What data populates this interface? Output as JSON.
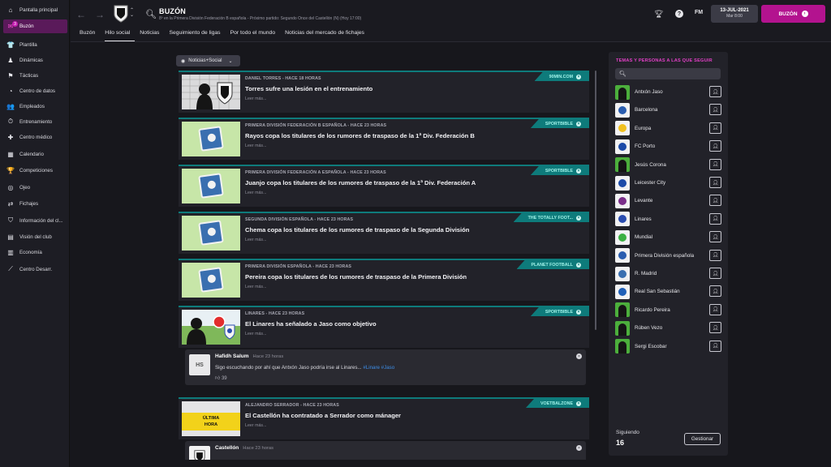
{
  "sidebar": {
    "items": [
      {
        "label": "Pantalla principal",
        "icon": "home-icon"
      },
      {
        "label": "Buzón",
        "icon": "inbox-icon",
        "badge": "3"
      },
      {
        "label": "Plantilla",
        "icon": "shirt-icon"
      },
      {
        "label": "Dinámicas",
        "icon": "dynamics-icon"
      },
      {
        "label": "Tácticas",
        "icon": "tactics-icon"
      },
      {
        "label": "Centro de datos",
        "icon": "data-icon"
      },
      {
        "label": "Empleados",
        "icon": "staff-icon"
      },
      {
        "label": "Entrenamiento",
        "icon": "training-icon"
      },
      {
        "label": "Centro médico",
        "icon": "medical-icon"
      },
      {
        "label": "Calendario",
        "icon": "calendar-icon"
      },
      {
        "label": "Competiciones",
        "icon": "trophy-icon"
      },
      {
        "label": "Ojeo",
        "icon": "scouting-icon"
      },
      {
        "label": "Fichajes",
        "icon": "transfers-icon"
      },
      {
        "label": "Información del cl...",
        "icon": "club-info-icon"
      },
      {
        "label": "Visión del club",
        "icon": "club-vision-icon"
      },
      {
        "label": "Economía",
        "icon": "finance-icon"
      },
      {
        "label": "Centro Desarr.",
        "icon": "development-icon"
      }
    ]
  },
  "header": {
    "title": "BUZÓN",
    "subtitle": "8º en la Primera División Federación B española - Próximo partido: Segundo Once del Castellón (N) (Hoy 17:00)",
    "date": "13-JUL-2021",
    "time": "Mar 8:00",
    "main_button": "BUZÓN",
    "fm_label": "FM",
    "help_label": "?"
  },
  "tabs": [
    "Buzón",
    "Hilo social",
    "Noticias",
    "Seguimiento de ligas",
    "Por todo el mundo",
    "Noticias del mercado de fichajes"
  ],
  "filter": {
    "label": "Noticias+Social"
  },
  "feed": {
    "read_more": "Leer más...",
    "cards": [
      {
        "meta": "DANIEL TORRES  -  HACE 18 HORAS",
        "headline": "Torres sufre una lesión en el entrenamiento",
        "source": "90MIN.COM"
      },
      {
        "meta": "PRIMERA DIVISIÓN FEDERACIÓN B ESPAÑOLA  -  HACE 23 HORAS",
        "headline": "Rayos copa los titulares de los rumores de traspaso de la 1ª Div. Federación B",
        "source": "SPORTBIBLE"
      },
      {
        "meta": "PRIMERA DIVISIÓN FEDERACIÓN A ESPAÑOLA  -  HACE 23 HORAS",
        "headline": "Juanjo copa los titulares de los rumores de traspaso de la 1ª Div. Federación A",
        "source": "SPORTBIBLE"
      },
      {
        "meta": "SEGUNDA DIVISIÓN ESPAÑOLA  -  HACE 23 HORAS",
        "headline": "Chema copa los titulares de los rumores de traspaso de la Segunda División",
        "source": "THE TOTALLY FOOT..."
      },
      {
        "meta": "PRIMERA DIVISIÓN ESPAÑOLA  -  HACE 23 HORAS",
        "headline": "Pereira copa los titulares de los rumores de traspaso de la Primera División",
        "source": "PLANET FOOTBALL"
      },
      {
        "meta": "LINARES  -  HACE 23 HORAS",
        "headline": "El Linares ha señalado a Jaso como objetivo",
        "source": "SPORTBIBLE"
      },
      {
        "meta": "ALEJANDRO SERRADOR  -  HACE 23 HORAS",
        "headline": "El Castellón ha contratado a Serrador como mánager",
        "source": "VOETBALZONE"
      }
    ],
    "tweet": {
      "avatar": "HS",
      "author": "Hafidh Salum",
      "when": "Hace 23 horas",
      "body": "Sigo escuchando por ahí que Antxón Jaso podría irse al Linares... ",
      "tags": "#Linare #Jaso",
      "likes": "39"
    },
    "tweet2": {
      "author": "Castellón",
      "when": "Hace 23 horas"
    },
    "ultima_hora_1": "ÚLTIMA",
    "ultima_hora_2": "HORA"
  },
  "right_panel": {
    "title": "TEMAS Y PERSONAS A LAS QUE SEGUIR",
    "search_icon": "search-icon",
    "following_label": "Siguiendo",
    "following_count": "16",
    "manage_label": "Gestionar",
    "items": [
      {
        "name": "Antxón Jaso",
        "type": "person"
      },
      {
        "name": "Barcelona",
        "type": "club",
        "color": "#2a5db0"
      },
      {
        "name": "Europa",
        "type": "club",
        "color": "#f0c020"
      },
      {
        "name": "FC Porto",
        "type": "club",
        "color": "#1c4aa8"
      },
      {
        "name": "Jesús Corona",
        "type": "person"
      },
      {
        "name": "Leicester City",
        "type": "club",
        "color": "#1c4aa8"
      },
      {
        "name": "Levante",
        "type": "club",
        "color": "#7a2e8a"
      },
      {
        "name": "Linares",
        "type": "club",
        "color": "#2a4db0"
      },
      {
        "name": "Mundial",
        "type": "club",
        "color": "#3bb043"
      },
      {
        "name": "Primera División española",
        "type": "club",
        "color": "#2a5db0"
      },
      {
        "name": "R. Madrid",
        "type": "club",
        "color": "#3a6fb0"
      },
      {
        "name": "Real San Sebastián",
        "type": "club",
        "color": "#1f5fb8"
      },
      {
        "name": "Ricardo Pereira",
        "type": "person"
      },
      {
        "name": "Rúben Vezo",
        "type": "person"
      },
      {
        "name": "Sergi Escobar",
        "type": "person"
      }
    ]
  },
  "colors": {
    "accent": "#b3138f",
    "teal": "#0e7b7b",
    "title_pink": "#e33fc7"
  }
}
